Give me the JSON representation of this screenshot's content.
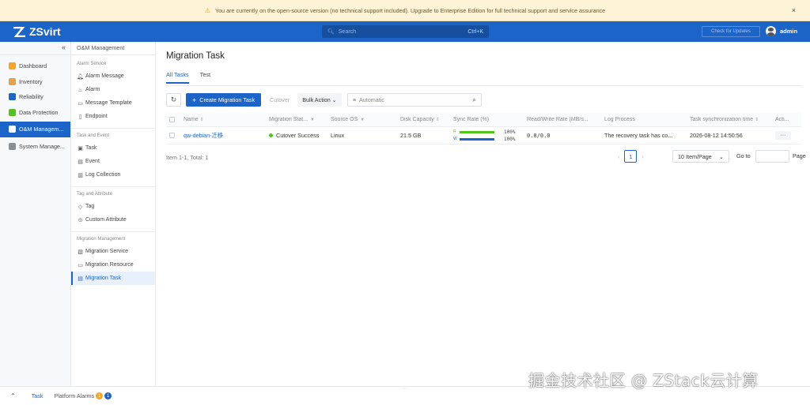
{
  "banner": {
    "text": "You are currently on the open-source version (no technical support included). Upgrade to Enterprise Edition for full technical support and service assurance",
    "close": "×"
  },
  "topbar": {
    "brand": "ZSvirt",
    "search_placeholder": "Search",
    "search_shortcut": "Ctrl+K",
    "update_label": "Check for Updates",
    "username": "admin"
  },
  "sidebar": {
    "collapse": "«",
    "items": [
      {
        "label": "Dashboard",
        "icon": "dashboard-icon",
        "color": "#f5a623"
      },
      {
        "label": "Inventory",
        "icon": "inventory-icon",
        "color": "#1c64c7"
      },
      {
        "label": "Reliability",
        "icon": "reliability-icon",
        "color": "#1c64c7"
      },
      {
        "label": "Data Protection",
        "icon": "data-protection-icon",
        "color": "#52c41a"
      },
      {
        "label": "O&M Managem...",
        "icon": "om-management-icon",
        "color": "#ffffff"
      },
      {
        "label": "System Manage...",
        "icon": "system-management-icon",
        "color": "#888888"
      }
    ]
  },
  "submenu": {
    "title": "O&M Management",
    "groups": [
      {
        "name": "Alarm Service",
        "items": [
          "Alarm Message",
          "Alarm",
          "Message Template",
          "Endpoint"
        ]
      },
      {
        "name": "Task and Event",
        "items": [
          "Task",
          "Event",
          "Log Collection"
        ]
      },
      {
        "name": "Tag and Attribute",
        "items": [
          "Tag",
          "Custom Attribute"
        ]
      },
      {
        "name": "Migration Management",
        "items": [
          "Migration Service",
          "Migration Resource",
          "Migration Task"
        ]
      }
    ]
  },
  "page": {
    "title": "Migration Task",
    "tabs": [
      "All Tasks",
      "Test"
    ],
    "toolbar": {
      "create": "Create Migration Task",
      "cutover": "Cutover",
      "bulk": "Bulk Action",
      "filter_placeholder": "Automatic"
    },
    "columns": [
      "Name",
      "Migration Stat...",
      "Source OS",
      "Disk Capacity",
      "Sync Rate (%)",
      "Read/Write Rate (MB/s...",
      "Log Process",
      "Task synchronization time",
      "Acti..."
    ],
    "rows": [
      {
        "name": "qw-debian-迁移",
        "status": "Cutover Success",
        "os": "Linux",
        "disk": "21.5 GB",
        "sync_r_label": "R",
        "sync_r": "100%",
        "sync_w_label": "W",
        "sync_w": "100%",
        "rw_rate": "0.0/0.0",
        "log": "The recovery task has co...",
        "time": "2026-08-12 14:50:56",
        "action": "···"
      }
    ],
    "summary": "Item 1-1, Total: 1",
    "pagination": {
      "current": "1",
      "per_page": "10 Item/Page",
      "goto": "Go to",
      "page_label": "Page"
    }
  },
  "bottom": {
    "task": "Task",
    "alarms": "Platform Alarms",
    "badge1": "1",
    "badge2": "1"
  },
  "watermark": "掘金技术社区 @ ZStack云计算"
}
